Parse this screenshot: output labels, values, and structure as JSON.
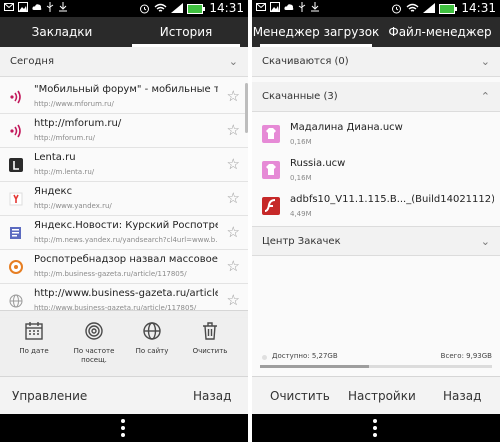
{
  "status_bar": {
    "time": "14:31"
  },
  "left_screen": {
    "tabs": [
      {
        "label": "Закладки",
        "active": false
      },
      {
        "label": "История",
        "active": true
      }
    ],
    "section": {
      "label": "Сегодня"
    },
    "history": [
      {
        "title": "\"Мобильный форум\" - мобильные тел...",
        "url": "http://www.mforum.ru/",
        "icon": "mforum-icon"
      },
      {
        "title": "http://mforum.ru/",
        "url": "http://mforum.ru/",
        "icon": "mforum-icon"
      },
      {
        "title": "Lenta.ru",
        "url": "http://m.lenta.ru/",
        "icon": "lenta-icon"
      },
      {
        "title": "Яндекс",
        "url": "http://www.yandex.ru/",
        "icon": "yandex-icon"
      },
      {
        "title": "Яндекс.Новости: Курский Роспотребн...",
        "url": "http://m.news.yandex.ru/yandsearch?cl4url=www.b...",
        "icon": "yandex-news-icon"
      },
      {
        "title": "Роспотребнадзор назвал массовое ув...",
        "url": "http://m.business-gazeta.ru/article/117805/",
        "icon": "business-gazeta-icon"
      },
      {
        "title": "http://www.business-gazeta.ru/article/...",
        "url": "http://www.business-gazeta.ru/article/117805/",
        "icon": "globe-icon"
      }
    ],
    "actions": [
      {
        "label": "По дате",
        "icon": "calendar-icon"
      },
      {
        "label": "По частоте посещ.",
        "icon": "fingerprint-icon"
      },
      {
        "label": "По сайту",
        "icon": "globe-icon"
      },
      {
        "label": "Очистить",
        "icon": "trash-icon"
      }
    ],
    "bottom": {
      "manage": "Управление",
      "back": "Назад"
    }
  },
  "right_screen": {
    "tabs": [
      {
        "label": "Менеджер загрузок",
        "active": true
      },
      {
        "label": "Файл-менеджер",
        "active": false
      }
    ],
    "downloading": {
      "label": "Скачиваются (0)"
    },
    "downloaded": {
      "label": "Скачанные (3)"
    },
    "files": [
      {
        "name": "Мадалина Диана.ucw",
        "size": "0,16M",
        "icon": "theme-file-icon"
      },
      {
        "name": "Russia.ucw",
        "size": "0,16M",
        "icon": "theme-file-icon"
      },
      {
        "name": "adbfs10_V11.1.115.B..._(Build14021112).apk",
        "size": "4,49M",
        "icon": "flash-icon"
      }
    ],
    "center": {
      "label": "Центр Закачек"
    },
    "storage": {
      "free": "Доступно: 5,27GB",
      "total": "Всего: 9,93GB",
      "used_fraction": 0.47
    },
    "bottom": {
      "clear": "Очистить",
      "settings": "Настройки",
      "back": "Назад"
    }
  }
}
